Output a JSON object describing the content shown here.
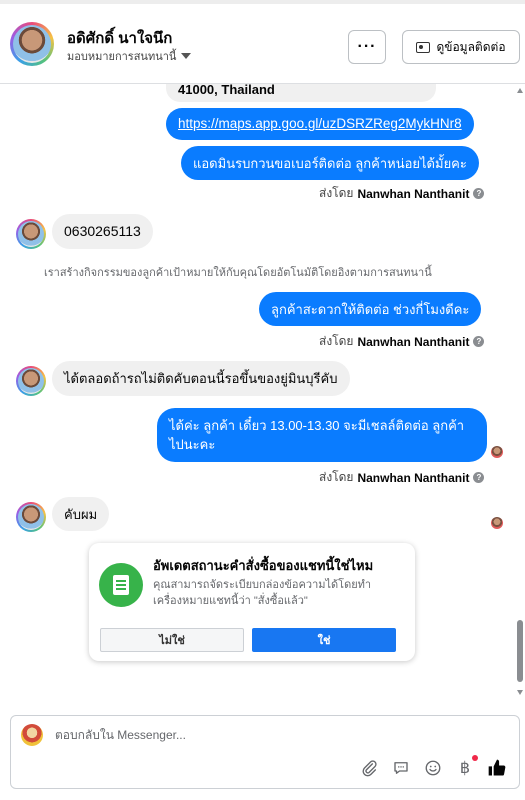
{
  "header": {
    "contact_name": "อดิศักดิ์ นาใจนึก",
    "assign_label": "มอบหมายการสนทนานี้",
    "more_label": "···",
    "info_button_label": "ดูข้อมูลติดต่อ"
  },
  "messages": {
    "address_tail": "41000, Thailand",
    "link_out": "https://maps.app.goo.gl/uzDSRZReg2MykHNr8",
    "out1": "แอดมินรบกวนขอเบอร์ติดต่อ ลูกค้าหน่อยได้มั้ยคะ",
    "in_phone": "0630265113",
    "system_note": "เราสร้างกิจกรรมของลูกค้าเป้าหมายให้กับคุณโดยอัตโนมัติโดยอิงตามการสนทนานี้",
    "out2": "ลูกค้าสะดวกให้ติดต่อ ช่วงกี่โมงดีคะ",
    "in2": "ได้ตลอดถ้ารถไม่ติดคับตอนนี้รอขึ้นของยู่มินบุรีคับ",
    "out3": "ได้ค่ะ ลูกค้า เดี๋ยว 13.00-13.30 จะมีเชลล์ติดต่อ ลูกค้าไปนะคะ",
    "in3": "คับผม",
    "sent_by_prefix": "ส่งโดย",
    "sent_by_name": "Nanwhan Nanthanit"
  },
  "prompt_card": {
    "title": "อัพเดตสถานะคำสั่งซื้อของแชทนี้ใช่ไหม",
    "body": "คุณสามารถจัดระเบียบกล่องข้อความได้โดยทำเครื่องหมายแชทนี้ว่า \"สั่งซื้อแล้ว\"",
    "no_label": "ไม่ใช่",
    "yes_label": "ใช่",
    "accent": "#37b34a"
  },
  "composer": {
    "placeholder": "ตอบกลับใน Messenger...",
    "icons": [
      "paperclip-icon",
      "speech-bubble-icon",
      "smiley-icon",
      "baht-icon",
      "thumbs-up-icon"
    ]
  },
  "colors": {
    "outgoing_bubble": "#0a7cff",
    "incoming_bubble": "#f0f0f0",
    "primary_button": "#1877f2"
  }
}
